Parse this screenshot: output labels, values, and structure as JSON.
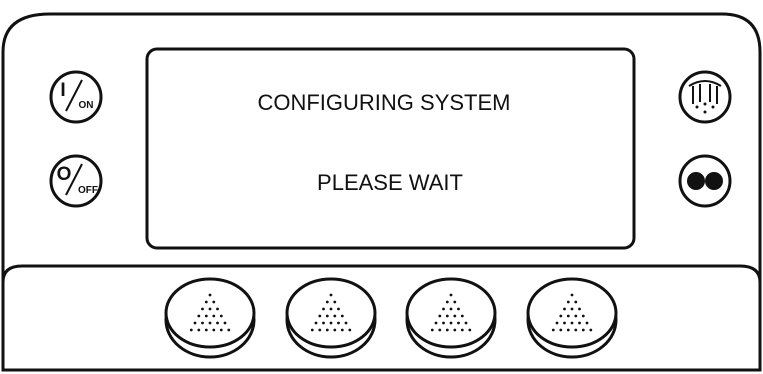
{
  "display": {
    "line1": "CONFIGURING SYSTEM",
    "line2": "PLEASE WAIT"
  },
  "buttons": {
    "on": {
      "big": "I",
      "small": "ON"
    },
    "off": {
      "big": "O",
      "small": "OFF"
    }
  },
  "colors": {
    "outline": "#111111",
    "background": "#ffffff"
  },
  "icons": {
    "on_button": "power-on-icon",
    "off_button": "power-off-icon",
    "top_right": "defrost-icon",
    "bottom_right": "manual-function-icon",
    "soft_keys": "soft-key-icon"
  }
}
